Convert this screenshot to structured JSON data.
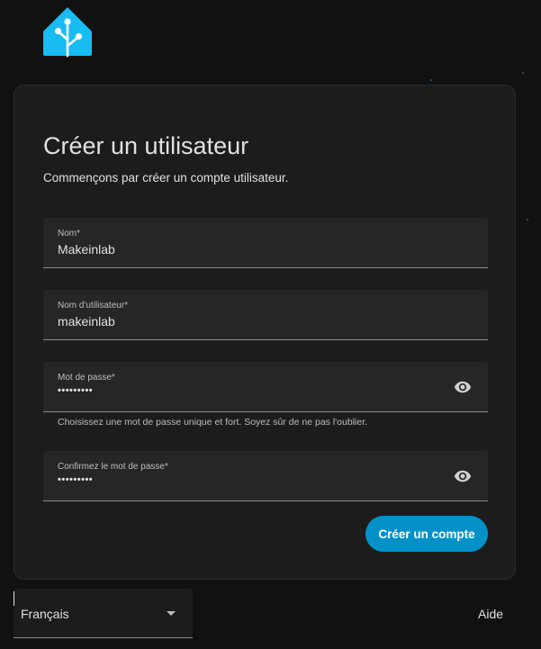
{
  "logo": {
    "icon": "home-assistant-logo-icon",
    "color": "#18bcf2"
  },
  "form": {
    "title": "Créer un utilisateur",
    "subtitle": "Commençons par créer un compte utilisateur.",
    "fields": {
      "name": {
        "label": "Nom*",
        "value": "Makeinlab"
      },
      "username": {
        "label": "Nom d'utilisateur*",
        "value": "makeinlab"
      },
      "password": {
        "label": "Mot de passe*",
        "value": "•••••••••",
        "icon": "eye-icon"
      },
      "confirm_password": {
        "label": "Confirmez le mot de passe*",
        "value": "•••••••••",
        "icon": "eye-icon"
      }
    },
    "password_helper": "Choisissez une mot de passe unique et fort. Soyez sûr de ne pas l'oublier.",
    "submit_label": "Créer un compte"
  },
  "footer": {
    "language": {
      "selected": "Français",
      "icon": "chevron-down-icon"
    },
    "help_label": "Aide"
  },
  "colors": {
    "accent": "#0391c8",
    "background": "#111111",
    "card": "#1c1c1c",
    "field": "#262626"
  }
}
